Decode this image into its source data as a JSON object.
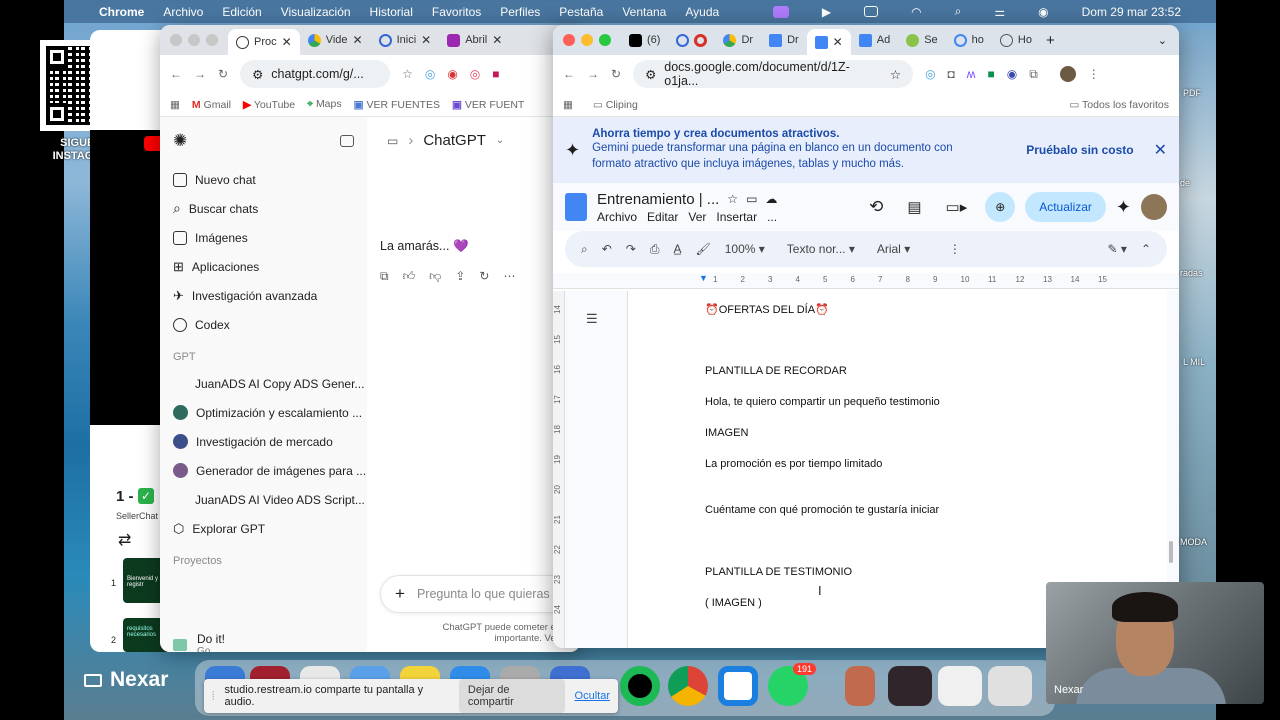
{
  "menubar": {
    "app": "Chrome",
    "items": [
      "Archivo",
      "Edición",
      "Visualización",
      "Historial",
      "Favoritos",
      "Perfiles",
      "Pestaña",
      "Ventana",
      "Ayuda"
    ],
    "datetime": "Dom 29 mar  23:52"
  },
  "overlay": {
    "follow_label": "SIGUEME INSTAGRAM"
  },
  "back_window": {
    "step_label": "1 -",
    "seller_text": "SellerChat",
    "item1": "1",
    "item2": "2",
    "banner_text": "Bienvenid y registr",
    "req_text": "requisitos necesarios"
  },
  "chatgpt_window": {
    "tabs": [
      {
        "label": "Proc",
        "active": true
      },
      {
        "label": "Vide"
      },
      {
        "label": "Inici"
      },
      {
        "label": "Abril"
      }
    ],
    "url": "chatgpt.com/g/...",
    "bookmarks": [
      "Gmail",
      "YouTube",
      "Maps",
      "VER FUENTES",
      "VER FUENT"
    ],
    "sidebar": {
      "items": [
        "Nuevo chat",
        "Buscar chats",
        "Imágenes",
        "Aplicaciones",
        "Investigación avanzada",
        "Codex"
      ],
      "gpt_section": "GPT",
      "gpts": [
        "JuanADS AI Copy ADS Gener...",
        "Optimización y escalamiento ...",
        "Investigación de mercado",
        "Generador de imágenes para ...",
        "JuanADS AI Video ADS Script...",
        "Explorar GPT"
      ],
      "projects_section": "Proyectos",
      "user_name": "Do it!",
      "user_plan": "Go"
    },
    "header_title": "ChatGPT",
    "message": "La amarás... 💜",
    "composer_placeholder": "Pregunta lo que quieras",
    "footer_note_1": "ChatGPT puede cometer erro",
    "footer_note_2": "importante. Ve"
  },
  "docs_window": {
    "tabs": [
      {
        "label": "(6)"
      },
      {
        "label": "Dr"
      },
      {
        "label": "Dr"
      },
      {
        "label": "",
        "active": true
      },
      {
        "label": "Ad"
      },
      {
        "label": "Se"
      },
      {
        "label": "ho"
      },
      {
        "label": "Ho"
      }
    ],
    "url": "docs.google.com/document/d/1Z-o1ja...",
    "bookmark_folder": "Cliping",
    "all_bookmarks": "Todos los favoritos",
    "gemini_banner": {
      "title": "Ahorra tiempo y crea documentos atractivos.",
      "body": "Gemini puede transformar una página en blanco en un documento con formato atractivo que incluya imágenes, tablas y mucho más.",
      "cta": "Pruébalo sin costo"
    },
    "doc_title": "Entrenamiento | ...",
    "menus": [
      "Archivo",
      "Editar",
      "Ver",
      "Insertar",
      "..."
    ],
    "update_button": "Actualizar",
    "toolbar": {
      "zoom": "100%",
      "style": "Texto nor...",
      "font": "Arial"
    },
    "ruler_numbers": [
      "1",
      "2",
      "3",
      "4",
      "5",
      "6",
      "7",
      "8",
      "9",
      "10",
      "11",
      "12",
      "13",
      "14",
      "15"
    ],
    "vruler_numbers": [
      "14",
      "15",
      "16",
      "17",
      "18",
      "19",
      "20",
      "21",
      "22",
      "23",
      "24"
    ],
    "lines": [
      "⏰OFERTAS DEL DÍA⏰",
      "PLANTILLA DE RECORDAR",
      "Hola, te quiero compartir un pequeño testimonio",
      "IMAGEN",
      "La promoción es por tiempo limitado",
      "Cuéntame con qué promoción te gustaría iniciar",
      "PLANTILLA DE TESTIMONIO",
      "( IMAGEN )"
    ]
  },
  "desktop_labels": [
    "PDF",
    "de",
    "radas",
    "L MIL",
    "MODA"
  ],
  "dock": {
    "whatsapp_badge": "191"
  },
  "share_notice": {
    "text": "studio.restream.io comparte tu pantalla y audio.",
    "stop": "Dejar de compartir",
    "hide": "Ocultar"
  },
  "brand_left": "Nexar",
  "webcam_name": "Nexar"
}
